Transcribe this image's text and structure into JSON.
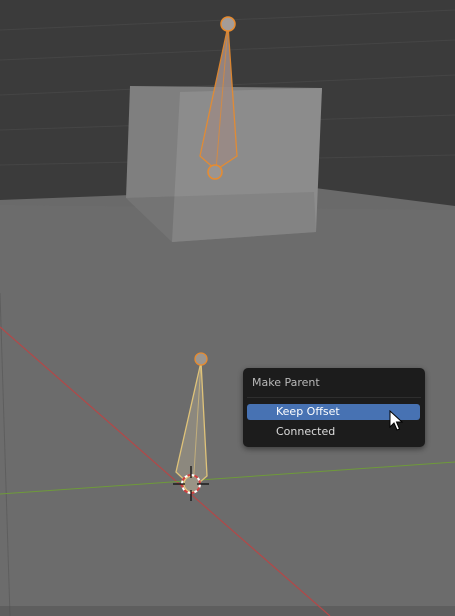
{
  "popup": {
    "title": "Make Parent",
    "items": [
      {
        "label": "Keep Offset",
        "active": true
      },
      {
        "label": "Connected",
        "active": false
      }
    ]
  },
  "colors": {
    "menu_bg": "#1c1c1c",
    "menu_highlight": "#4772b3",
    "bone_selected": "#e88b2e",
    "bone_active_parent": "#e6c87a",
    "x_axis": "#c44a4a",
    "y_axis": "#6e9a3a"
  },
  "icons": [
    "mouse-pointer-icon",
    "3d-cursor-icon"
  ]
}
